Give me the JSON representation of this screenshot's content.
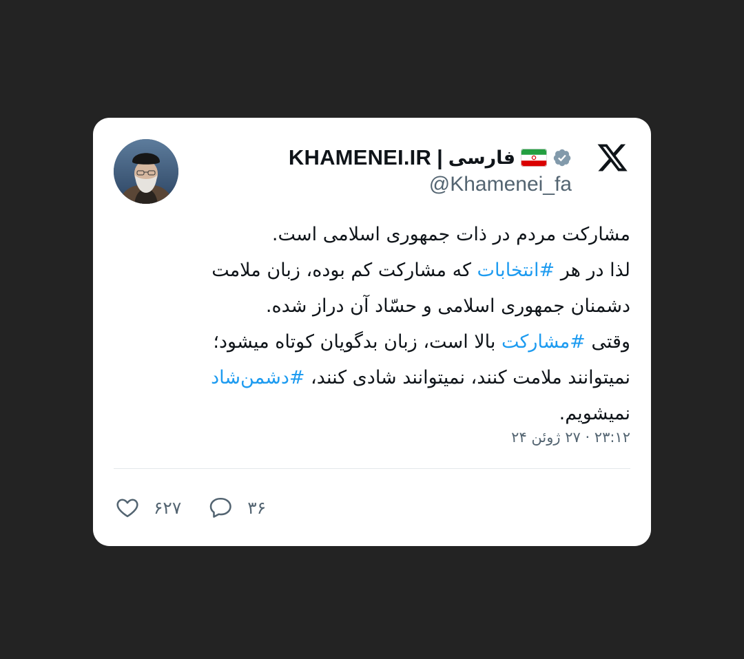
{
  "tweet": {
    "author_name": "KHAMENEI.IR",
    "separator": "|",
    "language_label": "فارسی",
    "flag_icon": "iran-flag-icon",
    "verified_icon": "verified-badge-icon",
    "handle": "@Khamenei_fa",
    "platform_icon": "x-logo-icon",
    "body": {
      "line1": "مشارکت مردم در ذات جمهوری اسلامی است.",
      "line2_pre": "لذا در هر ",
      "line2_tag": "#انتخابات",
      "line2_post": " که مشارکت کم بوده، زبان ملامت",
      "line3": "دشمنان جمهوری اسلامی و حسّاد آن دراز شده.",
      "line4_pre": "وقتی ",
      "line4_tag": "#مشارکت",
      "line4_post": " بالا است، زبان بدگویان کوتاه میشود؛",
      "line5_pre": "نمیتوانند ملامت کنند، نمیتوانند شادی کنند، ",
      "line5_tag": "#دشمن‌شاد",
      "line6": "نمیشویم."
    },
    "timestamp": "۲۳:۱۲ · ۲۷ ژوئن ۲۴",
    "likes_count": "۶۲۷",
    "replies_count": "۳۶"
  },
  "colors": {
    "background": "#232323",
    "card": "#ffffff",
    "text": "#0f1419",
    "muted": "#536471",
    "hashtag": "#1d9bf0",
    "verified": "#829aab"
  }
}
